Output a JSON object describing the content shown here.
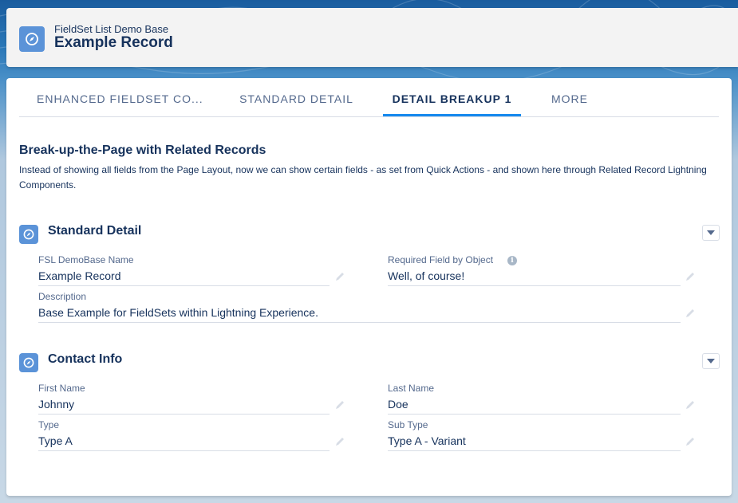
{
  "header": {
    "object_label": "FieldSet List Demo Base",
    "record_title": "Example Record",
    "icon": "compass-icon"
  },
  "tabs": [
    {
      "label": "ENHANCED FIELDSET CO...",
      "active": false
    },
    {
      "label": "STANDARD DETAIL",
      "active": false
    },
    {
      "label": "DETAIL BREAKUP 1",
      "active": true
    },
    {
      "label": "MORE",
      "active": false
    }
  ],
  "intro": {
    "title": "Break-up-the-Page with Related Records",
    "text": "Instead of showing all fields from the Page Layout, now we can show certain fields - as set from Quick Actions - and shown here through Related Record Lightning Components."
  },
  "sections": [
    {
      "title": "Standard Detail",
      "fields": [
        {
          "label": "FSL DemoBase Name",
          "value": "Example Record"
        },
        {
          "label": "Required Field by Object",
          "value": "Well, of course!",
          "info": "i"
        },
        {
          "label": "Description",
          "value": "Base Example for FieldSets within Lightning Experience."
        }
      ]
    },
    {
      "title": "Contact Info",
      "fields": [
        {
          "label": "First Name",
          "value": "Johnny"
        },
        {
          "label": "Last Name",
          "value": "Doe"
        },
        {
          "label": "Type",
          "value": "Type A"
        },
        {
          "label": "Sub Type",
          "value": "Type A - Variant"
        }
      ]
    }
  ],
  "colors": {
    "brand_icon": "#5b93d8",
    "active_tab_underline": "#1589ee",
    "text_primary": "#16325c",
    "text_label": "#54698d"
  }
}
